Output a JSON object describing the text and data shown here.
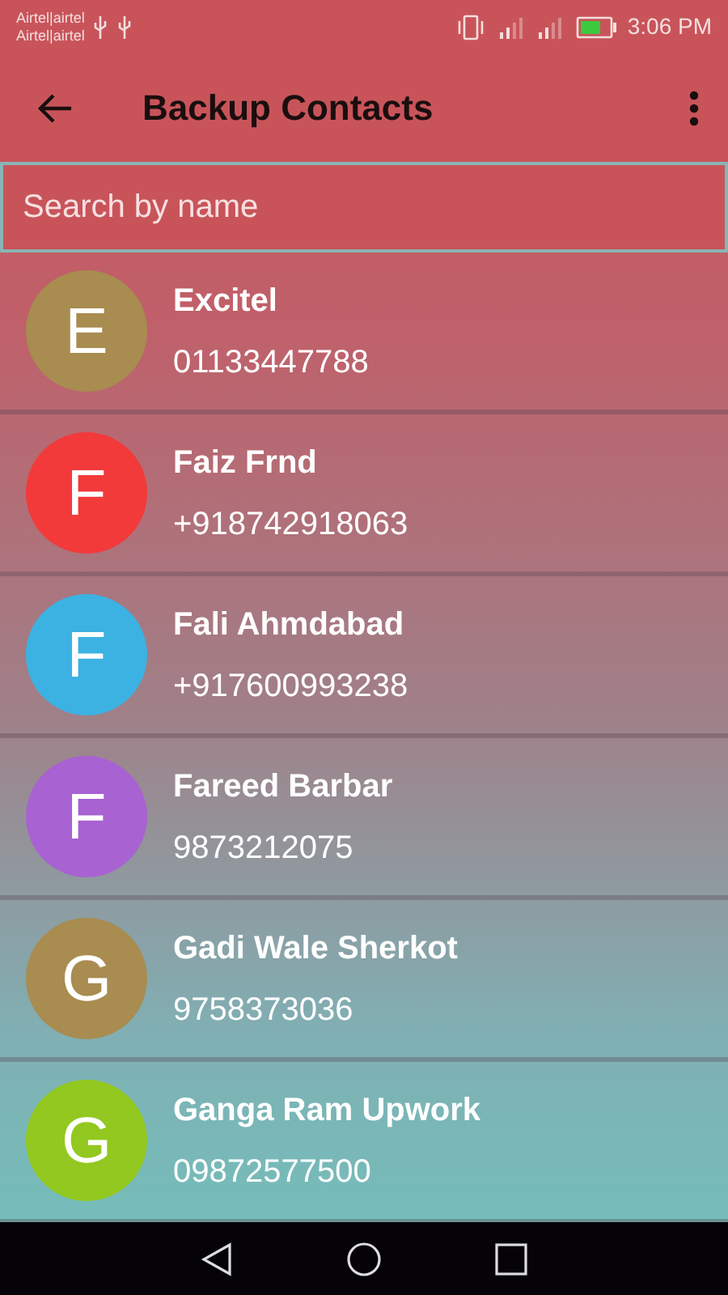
{
  "status_bar": {
    "carriers": [
      "Airtel|airtel",
      "Airtel|airtel"
    ],
    "time": "3:06 PM"
  },
  "toolbar": {
    "title": "Backup Contacts"
  },
  "search": {
    "placeholder": "Search by name"
  },
  "contacts": [
    {
      "initial": "E",
      "name": "Excitel",
      "phone": "01133447788",
      "color": "#a88c50"
    },
    {
      "initial": "F",
      "name": "Faiz Frnd",
      "phone": "+918742918063",
      "color": "#f23a3a"
    },
    {
      "initial": "F",
      "name": "Fali Ahmdabad",
      "phone": "+917600993238",
      "color": "#3cb2e2"
    },
    {
      "initial": "F",
      "name": "Fareed Barbar",
      "phone": "9873212075",
      "color": "#a862d2"
    },
    {
      "initial": "G",
      "name": "Gadi Wale Sherkot",
      "phone": "9758373036",
      "color": "#a88c50"
    },
    {
      "initial": "G",
      "name": "Ganga Ram Upwork",
      "phone": "09872577500",
      "color": "#92c820"
    }
  ]
}
